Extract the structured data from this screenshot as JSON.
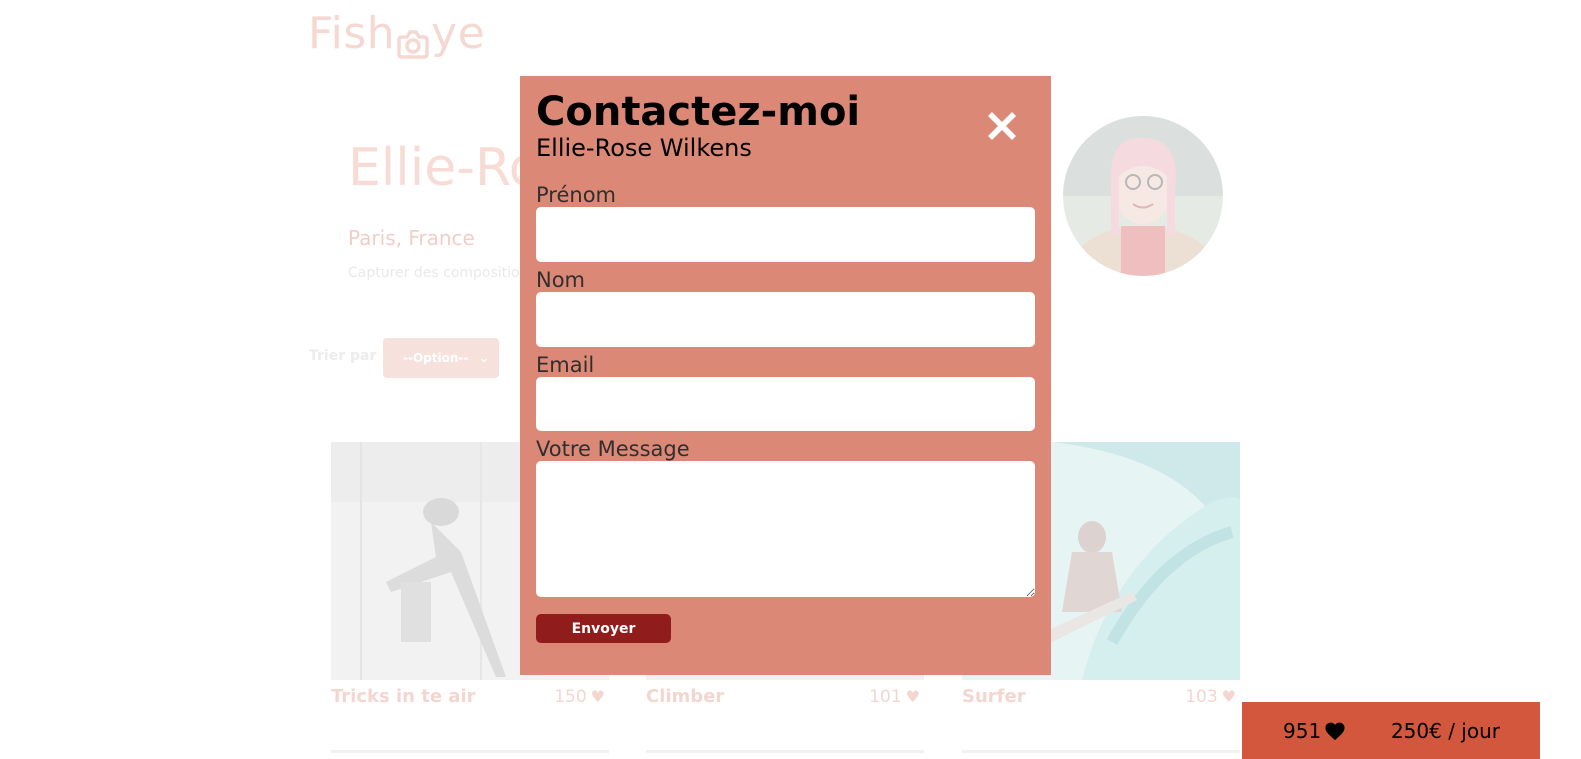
{
  "logo": {
    "text_left": "Fish",
    "text_right": "ye"
  },
  "photographer": {
    "name": "Ellie-Ro",
    "location": "Paris, France",
    "tagline": "Capturer des compositions"
  },
  "sort": {
    "label": "Trier par",
    "selected": "--Option--"
  },
  "media": [
    {
      "title": "Tricks in te air",
      "likes": "150"
    },
    {
      "title": "Climber",
      "likes": "101"
    },
    {
      "title": "Surfer",
      "likes": "103"
    }
  ],
  "modal": {
    "title": "Contactez-moi",
    "subtitle": "Ellie-Rose Wilkens",
    "fields": {
      "firstname": {
        "label": "Prénom",
        "value": ""
      },
      "lastname": {
        "label": "Nom",
        "value": ""
      },
      "email": {
        "label": "Email",
        "value": ""
      },
      "message": {
        "label": "Votre Message",
        "value": ""
      }
    },
    "submit_label": "Envoyer"
  },
  "counter": {
    "total_likes": "951",
    "price": "250€ / jour"
  },
  "colors": {
    "modal_bg": "#db8876",
    "button_bg": "#901c1c",
    "counter_bg": "#d3573c"
  },
  "icons": {
    "close": "close-icon",
    "heart": "heart-icon",
    "select": "chevron-down-icon"
  }
}
